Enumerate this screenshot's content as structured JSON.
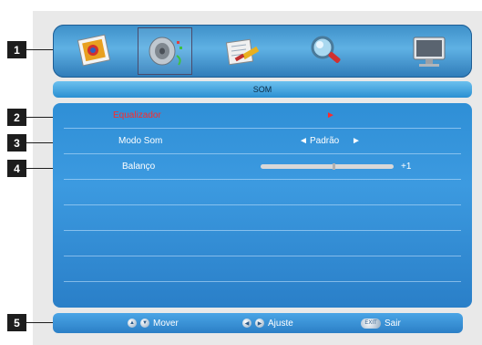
{
  "callouts": [
    "1",
    "2",
    "3",
    "4",
    "5"
  ],
  "icon_bar": {
    "icons": [
      "picture-icon",
      "sound-icon",
      "setup-icon",
      "search-icon",
      "monitor-icon"
    ],
    "selected": "sound-icon"
  },
  "title": "SOM",
  "menu": {
    "rows": [
      {
        "label": "Equalizador",
        "value": "►"
      },
      {
        "label": "Modo Som",
        "left_arrow": "◄",
        "value": "Padrão",
        "right_arrow": "►"
      },
      {
        "label": "Balanço",
        "value": "+1",
        "level": 0.55
      }
    ]
  },
  "footer": {
    "move_label": "Mover",
    "adjust_label": "Ajuste",
    "exit_key": "EXIT",
    "exit_label": "Sair"
  },
  "colors": {
    "active_text": "#ff2a2a",
    "panel_blue": "#2f8fd6"
  }
}
